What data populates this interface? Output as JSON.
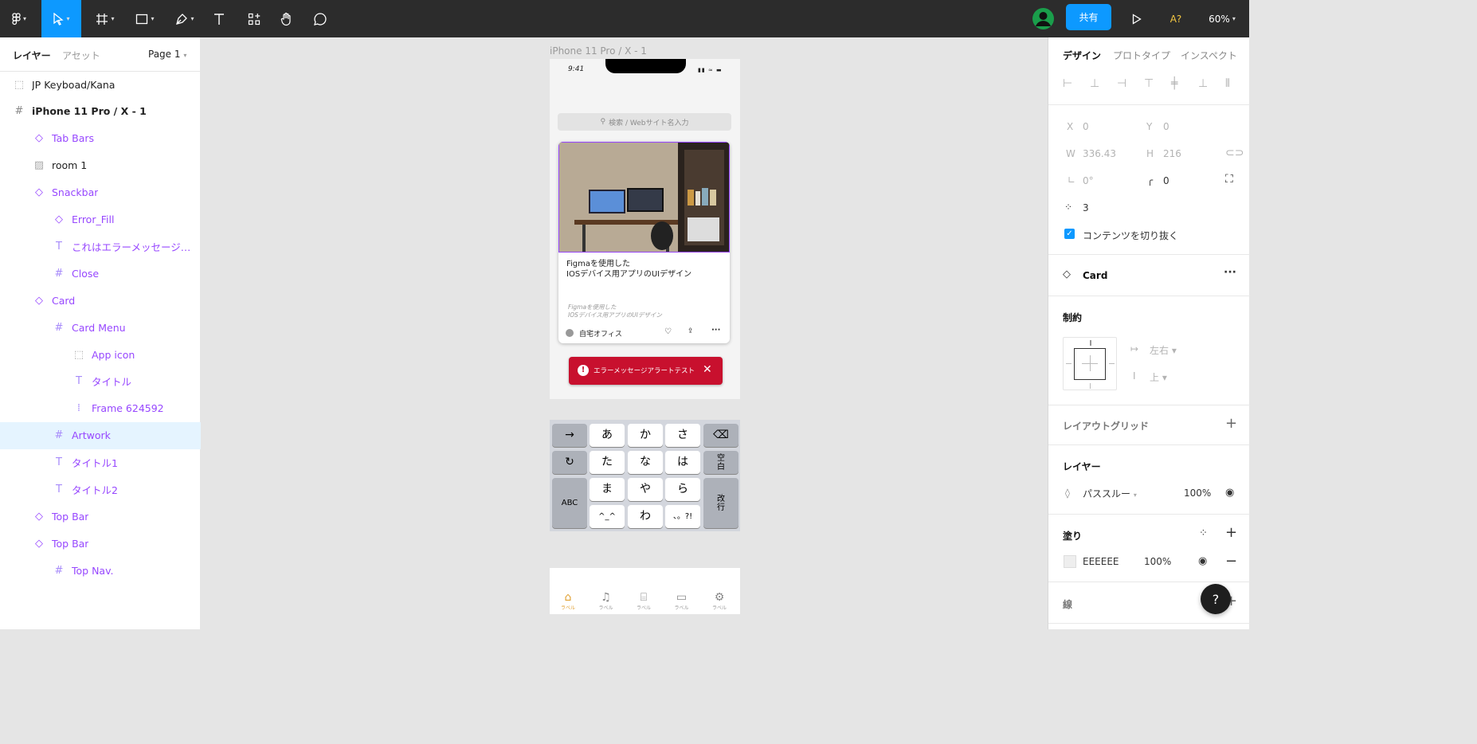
{
  "toolbar": {
    "share_label": "共有",
    "zoom": "60%",
    "font_warning": "A?",
    "tools": [
      "figma-menu-icon",
      "move-tool-icon",
      "frame-tool-icon",
      "shape-tool-icon",
      "pen-tool-icon",
      "text-tool-icon",
      "resources-icon",
      "hand-tool-icon",
      "comment-icon"
    ],
    "colors": {
      "bar": "#2c2c2c",
      "active_tool": "#0d99ff",
      "share": "#0d99ff",
      "warning": "#f5c842"
    }
  },
  "layers_panel": {
    "tab_layers": "レイヤー",
    "tab_assets": "アセット",
    "page": "Page 1",
    "items": [
      {
        "label": "JP Keyboad/Kana",
        "type": "group"
      },
      {
        "label": "iPhone 11 Pro / X - 1",
        "type": "frame"
      },
      {
        "label": "Tab Bars",
        "type": "instance"
      },
      {
        "label": "room 1",
        "type": "image"
      },
      {
        "label": "Snackbar",
        "type": "instance"
      },
      {
        "label": "Error_Fill",
        "type": "instance"
      },
      {
        "label": "これはエラーメッセージで...",
        "type": "text"
      },
      {
        "label": "Close",
        "type": "frame"
      },
      {
        "label": "Card",
        "type": "instance"
      },
      {
        "label": "Card Menu",
        "type": "frame"
      },
      {
        "label": "App icon",
        "type": "group"
      },
      {
        "label": "タイトル",
        "type": "text"
      },
      {
        "label": "Frame 624592",
        "type": "autolayout"
      },
      {
        "label": "Artwork",
        "type": "frame",
        "selected": true
      },
      {
        "label": "タイトル1",
        "type": "text"
      },
      {
        "label": "タイトル2",
        "type": "text"
      },
      {
        "label": "Top Bar",
        "type": "instance"
      },
      {
        "label": "Top Bar",
        "type": "instance"
      },
      {
        "label": "Top Nav.",
        "type": "frame"
      }
    ],
    "colors": {
      "component": "#9747ff",
      "selected_row": "#e5f4ff"
    }
  },
  "canvas": {
    "frame_label": "iPhone 11 Pro / X - 1",
    "phone": {
      "time": "9:41",
      "search_placeholder": "検索 / Webサイト名入力",
      "card_title_line1": "Figmaを使用した",
      "card_title_line2": "IOSデバイス用アプリのUIデザイン",
      "card_sub_line1": "Figmaを使用した",
      "card_sub_line2": "IOSデバイス用アプリのUIデザイン",
      "card_menu_label": "自宅オフィス",
      "snackbar_text": "エラーメッセージアラートテスト",
      "keyboard": {
        "row1": [
          "→",
          "あ",
          "か",
          "さ",
          "⌫"
        ],
        "row2": [
          "↻",
          "た",
          "な",
          "は",
          "空\n白"
        ],
        "row3": [
          "ABC",
          "ま",
          "や",
          "ら",
          "改\n行"
        ],
        "row4": [
          "^_^",
          "わ",
          "、。?!"
        ]
      },
      "tabbar": [
        {
          "icon": "home-icon",
          "label": "ラベル",
          "active": true
        },
        {
          "icon": "bell-icon",
          "label": "ラベル"
        },
        {
          "icon": "bank-icon",
          "label": "ラベル"
        },
        {
          "icon": "card-icon",
          "label": "ラベル"
        },
        {
          "icon": "settings-icon",
          "label": "ラベル"
        }
      ],
      "colors": {
        "snackbar": "#c8102e",
        "selection": "#9747ff",
        "active_tab": "#e0a030"
      }
    }
  },
  "design_panel": {
    "tabs": [
      "デザイン",
      "プロトタイプ",
      "インスペクト"
    ],
    "x_label": "X",
    "x": "0",
    "y_label": "Y",
    "y": "0",
    "w_label": "W",
    "w": "336.43",
    "h_label": "H",
    "h": "216",
    "rotation": "0°",
    "radius": "0",
    "count": "3",
    "clip_label": "コンテンツを切り抜く",
    "component_name": "Card",
    "constraints_title": "制約",
    "constraint_h": "左右",
    "constraint_v": "上",
    "layout_grid_title": "レイアウトグリッド",
    "layer_title": "レイヤー",
    "blend": "パススルー",
    "opacity": "100%",
    "fill_title": "塗り",
    "fill_hex": "EEEEEE",
    "fill_opacity": "100%",
    "stroke_title": "線",
    "help": "?"
  }
}
